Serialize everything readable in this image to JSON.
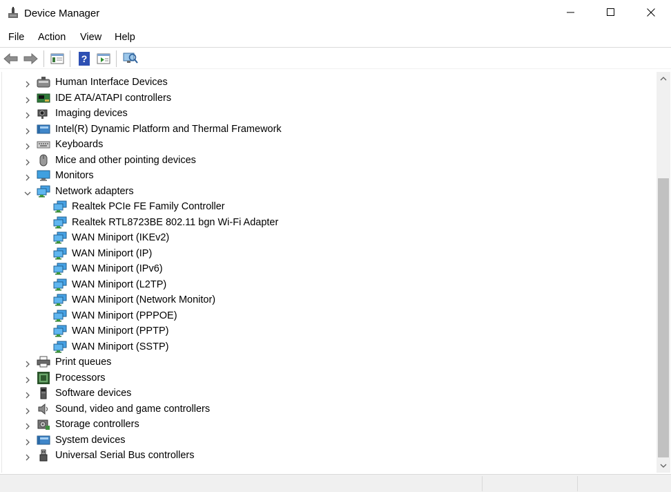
{
  "window": {
    "title": "Device Manager"
  },
  "menu": [
    "File",
    "Action",
    "View",
    "Help"
  ],
  "toolbar": [
    "back-arrow-icon",
    "forward-arrow-icon",
    "properties-icon",
    "help-icon",
    "update-driver-icon",
    "scan-hardware-icon"
  ],
  "tree": [
    {
      "label": "Human Interface Devices",
      "icon": "hid-icon",
      "level": 0,
      "expanded": false
    },
    {
      "label": "IDE ATA/ATAPI controllers",
      "icon": "ide-controller-icon",
      "level": 0,
      "expanded": false
    },
    {
      "label": "Imaging devices",
      "icon": "camera-icon",
      "level": 0,
      "expanded": false
    },
    {
      "label": "Intel(R) Dynamic Platform and Thermal Framework",
      "icon": "system-device-icon",
      "level": 0,
      "expanded": false
    },
    {
      "label": "Keyboards",
      "icon": "keyboard-icon",
      "level": 0,
      "expanded": false
    },
    {
      "label": "Mice and other pointing devices",
      "icon": "mouse-icon",
      "level": 0,
      "expanded": false
    },
    {
      "label": "Monitors",
      "icon": "monitor-icon",
      "level": 0,
      "expanded": false
    },
    {
      "label": "Network adapters",
      "icon": "network-adapter-icon",
      "level": 0,
      "expanded": true
    },
    {
      "label": "Realtek PCIe FE Family Controller",
      "icon": "network-adapter-icon",
      "level": 1
    },
    {
      "label": "Realtek RTL8723BE 802.11 bgn Wi-Fi Adapter",
      "icon": "network-adapter-icon",
      "level": 1
    },
    {
      "label": "WAN Miniport (IKEv2)",
      "icon": "network-adapter-icon",
      "level": 1
    },
    {
      "label": "WAN Miniport (IP)",
      "icon": "network-adapter-icon",
      "level": 1
    },
    {
      "label": "WAN Miniport (IPv6)",
      "icon": "network-adapter-icon",
      "level": 1
    },
    {
      "label": "WAN Miniport (L2TP)",
      "icon": "network-adapter-icon",
      "level": 1
    },
    {
      "label": "WAN Miniport (Network Monitor)",
      "icon": "network-adapter-icon",
      "level": 1
    },
    {
      "label": "WAN Miniport (PPPOE)",
      "icon": "network-adapter-icon",
      "level": 1
    },
    {
      "label": "WAN Miniport (PPTP)",
      "icon": "network-adapter-icon",
      "level": 1
    },
    {
      "label": "WAN Miniport (SSTP)",
      "icon": "network-adapter-icon",
      "level": 1
    },
    {
      "label": "Print queues",
      "icon": "printer-icon",
      "level": 0,
      "expanded": false
    },
    {
      "label": "Processors",
      "icon": "processor-icon",
      "level": 0,
      "expanded": false
    },
    {
      "label": "Software devices",
      "icon": "software-device-icon",
      "level": 0,
      "expanded": false
    },
    {
      "label": "Sound, video and game controllers",
      "icon": "speaker-icon",
      "level": 0,
      "expanded": false
    },
    {
      "label": "Storage controllers",
      "icon": "storage-controller-icon",
      "level": 0,
      "expanded": false
    },
    {
      "label": "System devices",
      "icon": "system-device-icon",
      "level": 0,
      "expanded": false
    },
    {
      "label": "Universal Serial Bus controllers",
      "icon": "usb-icon",
      "level": 0,
      "expanded": false
    }
  ]
}
